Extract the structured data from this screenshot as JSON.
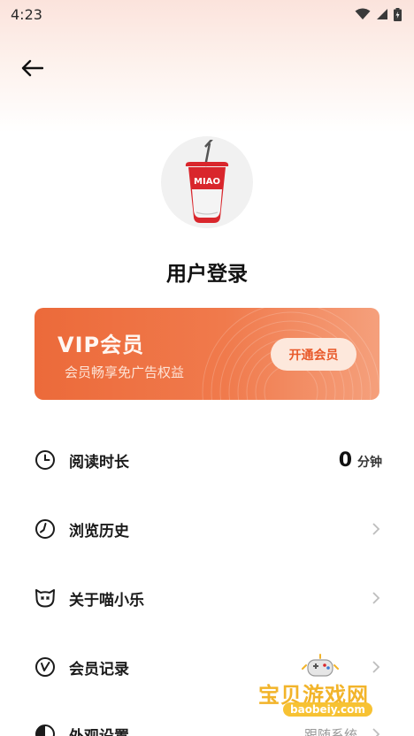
{
  "status_bar": {
    "time": "4:23"
  },
  "page": {
    "title": "用户登录"
  },
  "avatar": {
    "cup_text": "MIAO"
  },
  "vip": {
    "title": "VIP会员",
    "subtitle": "会员畅享免广告权益",
    "button_label": "开通会员"
  },
  "menu": {
    "items": [
      {
        "label": "阅读时长",
        "icon": "clock-icon",
        "value": "0",
        "unit": "分钟"
      },
      {
        "label": "浏览历史",
        "icon": "history-icon"
      },
      {
        "label": "关于喵小乐",
        "icon": "cat-face-icon"
      },
      {
        "label": "会员记录",
        "icon": "record-icon"
      },
      {
        "label": "外观设置",
        "icon": "appearance-icon",
        "value": "跟随系统"
      }
    ]
  },
  "watermark": {
    "title": "宝贝游戏网",
    "url": "baobeiy.com"
  },
  "colors": {
    "accent": "#ec6a3a",
    "vip_button_text": "#e8592a",
    "cup_red": "#d9262c"
  }
}
